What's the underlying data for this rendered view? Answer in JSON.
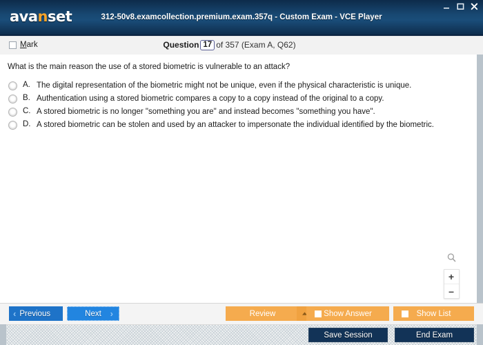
{
  "titlebar": {
    "logo_text_part1": "ava",
    "logo_accent": "n",
    "logo_text_part2": "set",
    "window_title": "312-50v8.examcollection.premium.exam.357q - Custom Exam - VCE Player",
    "minimize_icon": "minimize-icon",
    "maximize_icon": "maximize-icon",
    "close_icon": "close-icon"
  },
  "question_header": {
    "mark_label_accel": "M",
    "mark_label_rest": "ark",
    "question_word": "Question",
    "question_number": "17",
    "of_text": "of 357 (Exam A, Q62)"
  },
  "question": {
    "prompt": "What is the main reason the use of a stored biometric is vulnerable to an attack?",
    "options": [
      {
        "letter": "A.",
        "text": "The digital representation of the biometric might not be unique, even if the physical characteristic is unique.",
        "selected": false
      },
      {
        "letter": "B.",
        "text": "Authentication using a stored biometric compares a copy to a copy instead of the original to a copy.",
        "selected": false
      },
      {
        "letter": "C.",
        "text": "A stored biometric is no longer \"something you are\" and instead becomes \"something you have\".",
        "selected": false
      },
      {
        "letter": "D.",
        "text": "A stored biometric can be stolen and used by an attacker to impersonate the individual identified by the biometric.",
        "selected": false
      }
    ]
  },
  "zoom_widget": {
    "magnifier_icon": "magnifier-icon",
    "zoom_in_label": "+",
    "zoom_out_label": "–"
  },
  "buttons": {
    "previous": "Previous",
    "previous_chevron": "‹",
    "next": "Next",
    "next_chevron": "›",
    "review": "Review",
    "show_answer": "Show Answer",
    "show_list": "Show List",
    "save_session": "Save Session",
    "end_exam": "End Exam"
  },
  "colors": {
    "titlebar_dark": "#0d2b4a",
    "titlebar_light": "#1a4d79",
    "logo_accent": "#f5a32a",
    "blue_button": "#1e73c8",
    "blue_button_focus": "#2285e0",
    "orange_button": "#f5ab4e",
    "orange_button_caret": "#f0a241",
    "dark_button": "#123357",
    "panel_border": "#b9c3cb"
  }
}
